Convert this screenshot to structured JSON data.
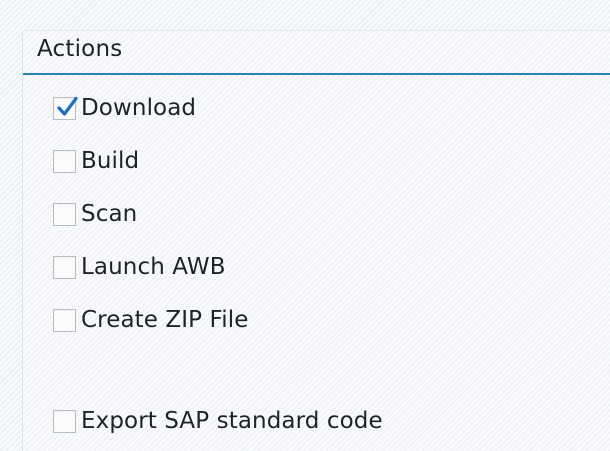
{
  "panel": {
    "title": "Actions"
  },
  "options": [
    {
      "label": "Download",
      "checked": true
    },
    {
      "label": "Build",
      "checked": false
    },
    {
      "label": "Scan",
      "checked": false
    },
    {
      "label": "Launch AWB",
      "checked": false
    },
    {
      "label": "Create ZIP File",
      "checked": false
    },
    {
      "label": "Export SAP standard code",
      "checked": false
    }
  ],
  "colors": {
    "accent": "#2d7fb8",
    "checkmark": "#1a6fc4",
    "text": "#1f2327"
  },
  "icons": {
    "checked": "checkmark-icon"
  }
}
